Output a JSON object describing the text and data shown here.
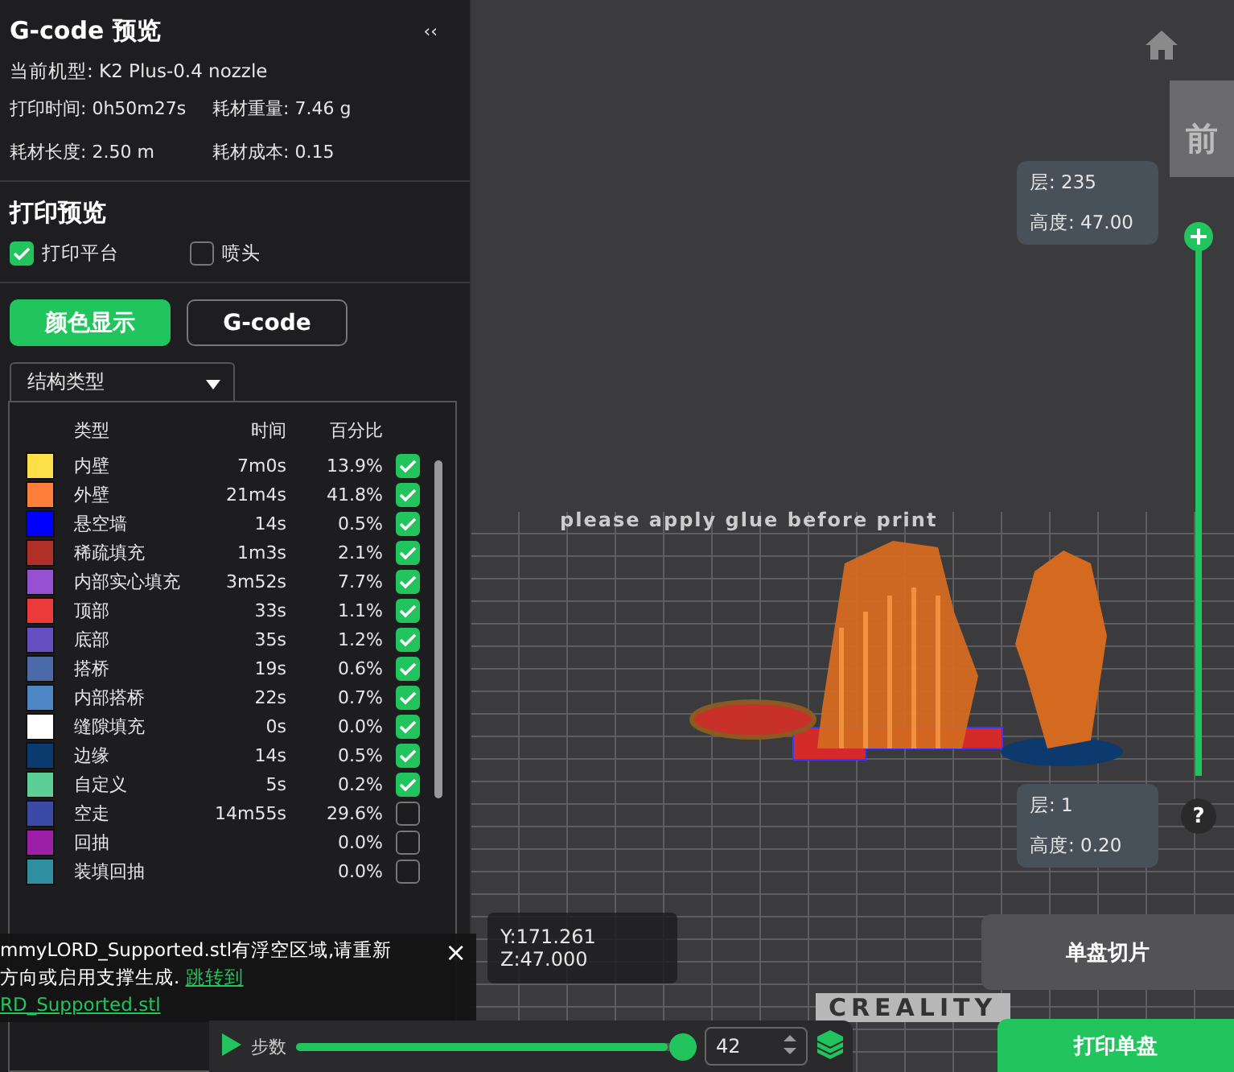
{
  "panel": {
    "title": "G-code 预览",
    "collapse": "‹‹",
    "machine": "当前机型: K2 Plus-0.4 nozzle",
    "stats": [
      "打印时间: 0h50m27s",
      "耗材重量: 7.46 g",
      "耗材长度: 2.50 m",
      "耗材成本: 0.15"
    ]
  },
  "preview": {
    "title": "打印预览",
    "options": [
      {
        "label": "打印平台",
        "checked": true
      },
      {
        "label": "喷头",
        "checked": false
      }
    ]
  },
  "view_modes": [
    {
      "label": "颜色显示",
      "selected": true
    },
    {
      "label": "G-code",
      "selected": false
    }
  ],
  "dropdown": {
    "value": "结构类型"
  },
  "legend": {
    "columns": [
      "类型",
      "时间",
      "百分比"
    ],
    "rows": [
      {
        "color": "#fde047",
        "label": "内壁",
        "time": "7m0s",
        "percent": "13.9%",
        "checked": true
      },
      {
        "color": "#ff7f3a",
        "label": "外壁",
        "time": "21m4s",
        "percent": "41.8%",
        "checked": true
      },
      {
        "color": "#0000ff",
        "label": "悬空墙",
        "time": "14s",
        "percent": "0.5%",
        "checked": true
      },
      {
        "color": "#b03028",
        "label": "稀疏填充",
        "time": "1m3s",
        "percent": "2.1%",
        "checked": true
      },
      {
        "color": "#9551d0",
        "label": "内部实心填充",
        "time": "3m52s",
        "percent": "7.7%",
        "checked": true
      },
      {
        "color": "#ec3a3a",
        "label": "顶部",
        "time": "33s",
        "percent": "1.1%",
        "checked": true
      },
      {
        "color": "#6450c0",
        "label": "底部",
        "time": "35s",
        "percent": "1.2%",
        "checked": true
      },
      {
        "color": "#4a6aa8",
        "label": "搭桥",
        "time": "19s",
        "percent": "0.6%",
        "checked": true
      },
      {
        "color": "#4f86c6",
        "label": "内部搭桥",
        "time": "22s",
        "percent": "0.7%",
        "checked": true
      },
      {
        "color": "#ffffff",
        "label": "缝隙填充",
        "time": "0s",
        "percent": "0.0%",
        "checked": true
      },
      {
        "color": "#0b3a6e",
        "label": "边缘",
        "time": "14s",
        "percent": "0.5%",
        "checked": true
      },
      {
        "color": "#5ccf96",
        "label": "自定义",
        "time": "5s",
        "percent": "0.2%",
        "checked": true
      },
      {
        "color": "#3b4aa6",
        "label": "空走",
        "time": "14m55s",
        "percent": "29.6%",
        "checked": false
      },
      {
        "color": "#9c1fa8",
        "label": "回抽",
        "percent": "0.0%",
        "checked": false
      },
      {
        "color": "#2f8fa0",
        "label": "装填回抽",
        "percent": "0.0%",
        "checked": false
      }
    ]
  },
  "position": {
    "text": "Y:171.261 Z:47.000"
  },
  "notification": {
    "lines": [
      "mmyLORD_Supported.stl有浮空区域,请重新",
      "方向或启用支撑生成."
    ],
    "links": [
      "跳转到",
      "RD_Supported.stl"
    ],
    "close": "×"
  },
  "plate": {
    "texts": [
      "please apply glue before print",
      "CREALITY"
    ]
  },
  "view_cube": {
    "face": "前"
  },
  "layer_slider": {
    "top": {
      "layer": "层: 235",
      "height": "高度: 47.00"
    },
    "bottom": {
      "layer": "层: 1",
      "height": "高度: 0.20"
    },
    "help": "?"
  },
  "bottom_bar": {
    "steps_label": "步数",
    "level": 1,
    "step_value": "42"
  },
  "slice_button": "单盘切片",
  "print_button": "打印单盘"
}
